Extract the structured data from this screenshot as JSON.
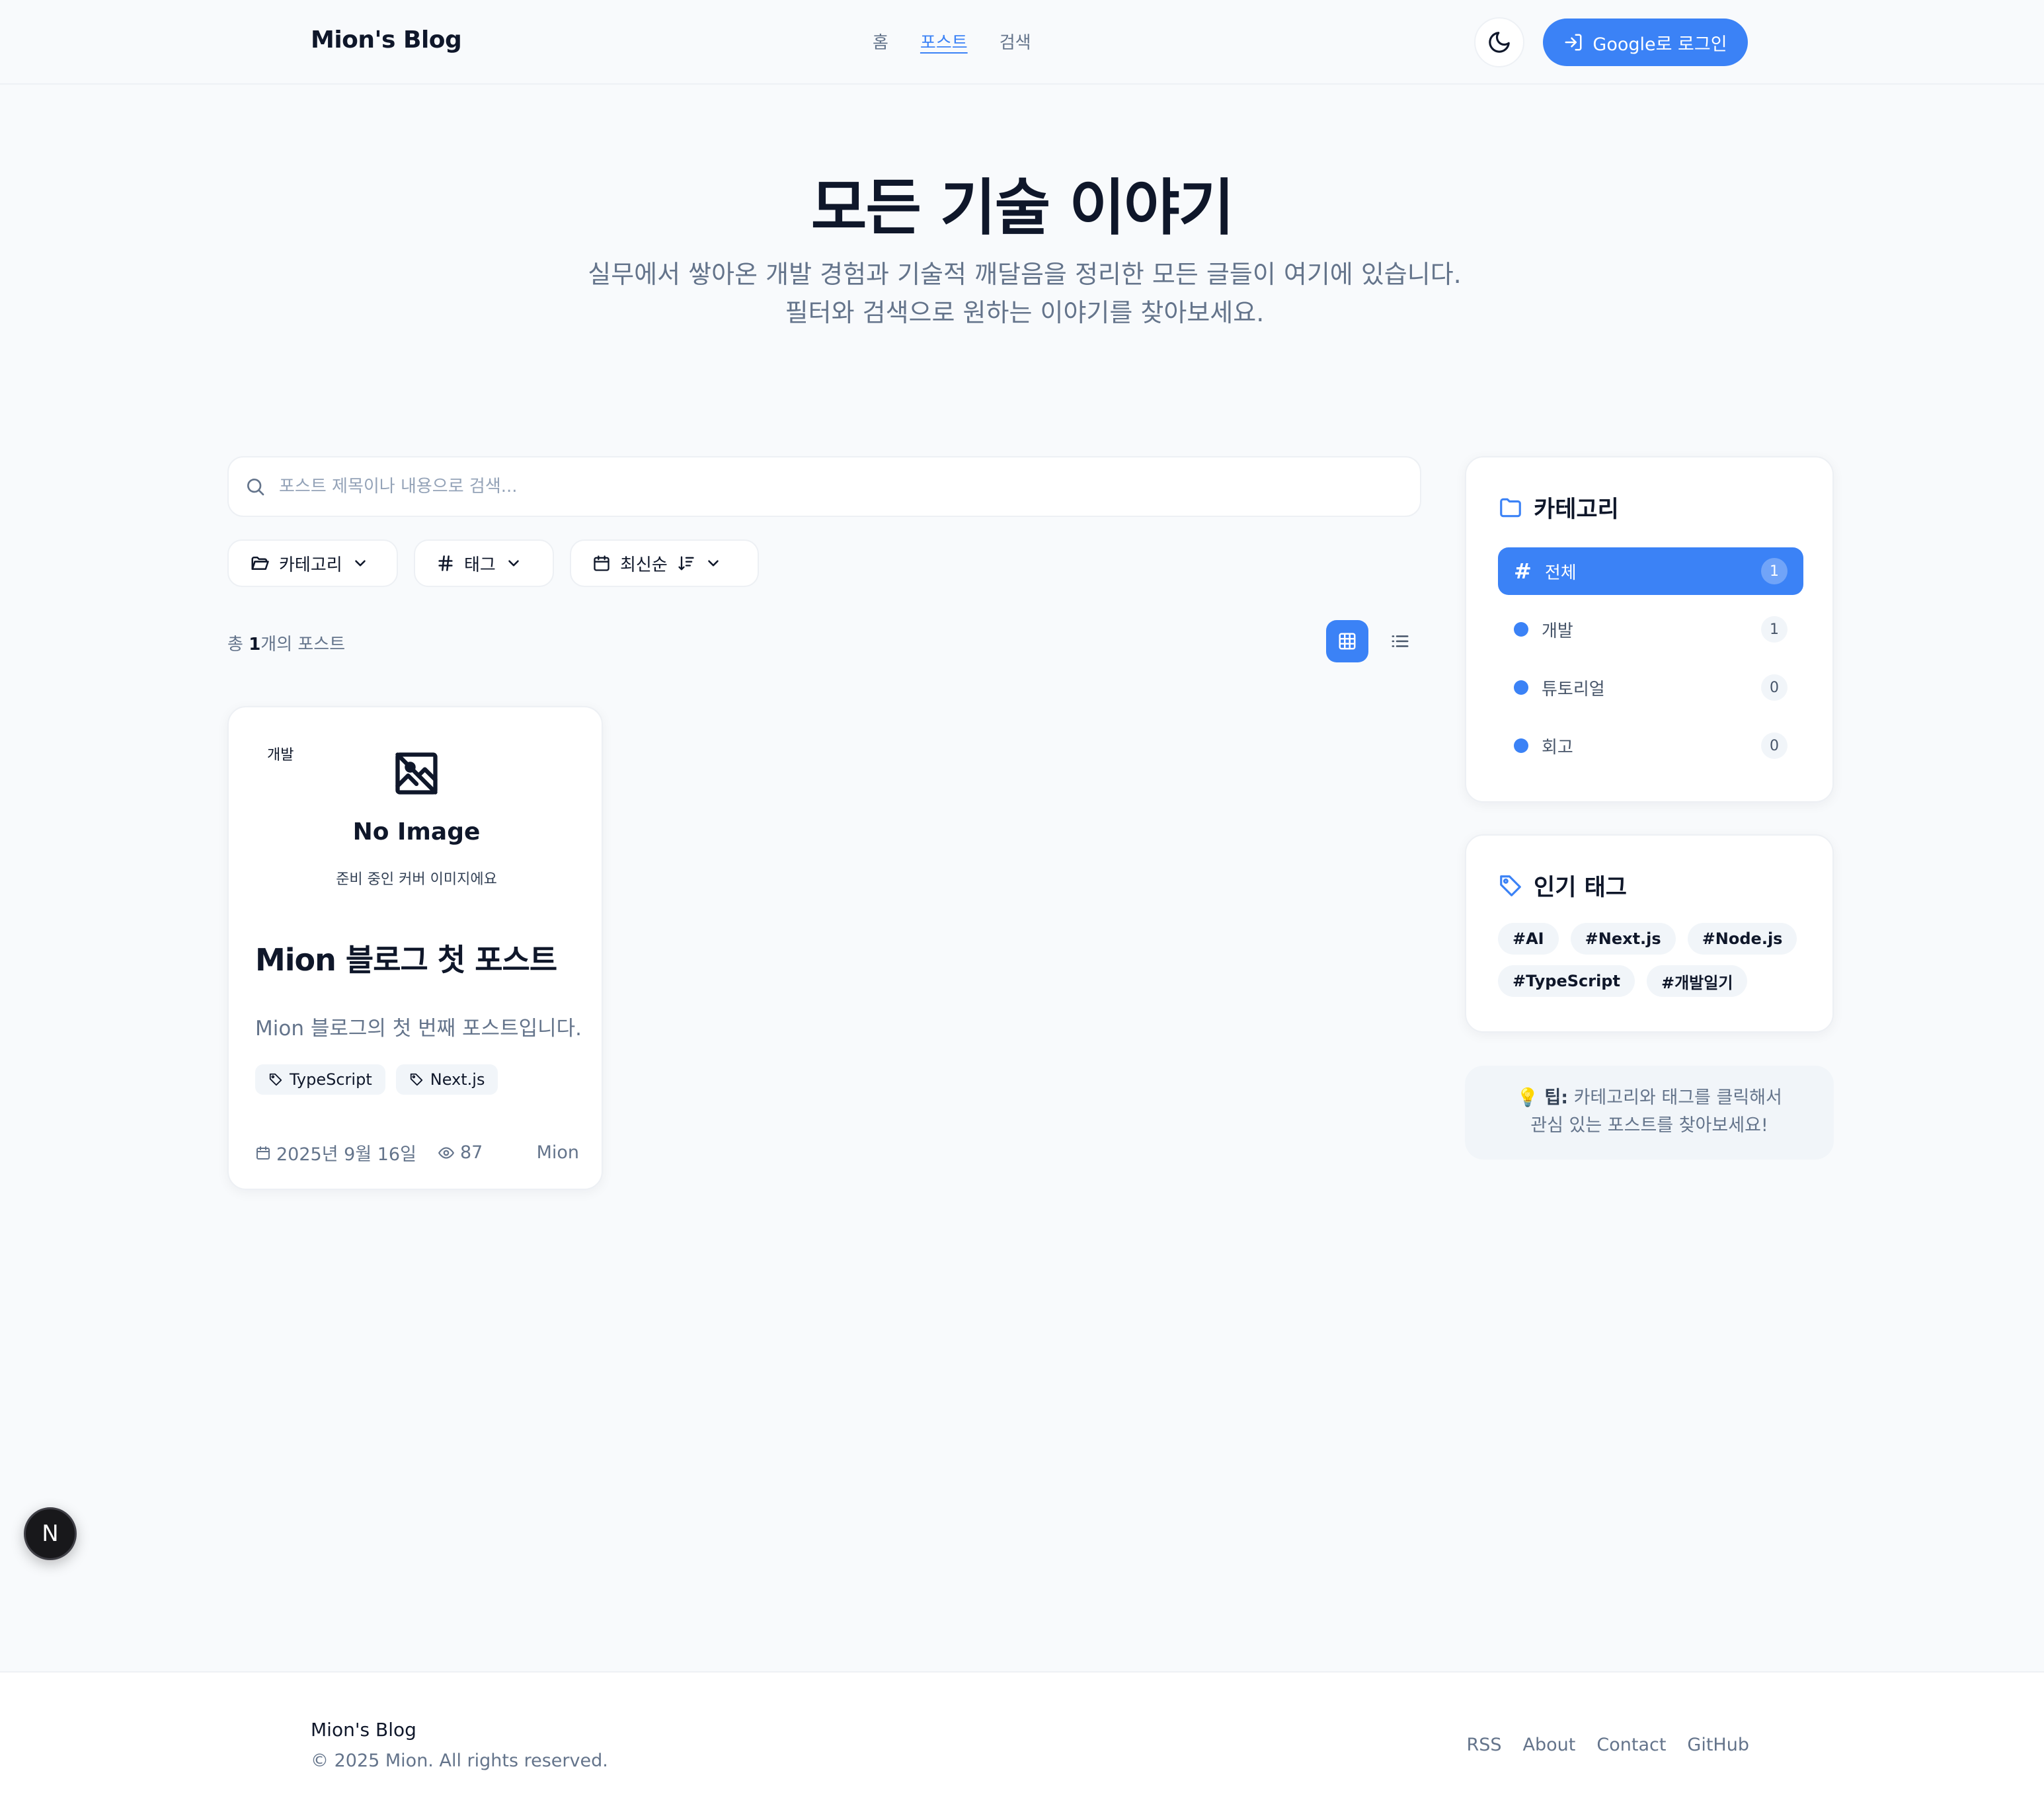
{
  "header": {
    "brand": "Mion's Blog",
    "nav": [
      {
        "label": "홈"
      },
      {
        "label": "포스트"
      },
      {
        "label": "검색"
      }
    ],
    "login_label": "Google로 로그인"
  },
  "hero": {
    "title": "모든 기술 이야기",
    "subtitle": "실무에서 쌓아온 개발 경험과 기술적 깨달음을 정리한 모든 글들이 여기에 있습니다. 필터와 검색으로 원하는 이야기를 찾아보세요."
  },
  "search": {
    "placeholder": "포스트 제목이나 내용으로 검색...",
    "value": ""
  },
  "filters": {
    "category": "카테고리",
    "tag": "태그",
    "sort": "최신순"
  },
  "results": {
    "prefix": "총 ",
    "count": "1",
    "suffix": "개의 포스트"
  },
  "post": {
    "category": "개발",
    "no_image_title": "No Image",
    "no_image_sub": "준비 중인 커버 이미지에요",
    "title": "Mion 블로그 첫 포스트",
    "excerpt": "Mion 블로그의 첫 번째 포스트입니다.",
    "tags": [
      "TypeScript",
      "Next.js"
    ],
    "date": "2025년 9월 16일",
    "views": "87",
    "author": "Mion"
  },
  "sidebar": {
    "categories_title": "카테고리",
    "categories": [
      {
        "label": "전체",
        "count": "1"
      },
      {
        "label": "개발",
        "count": "1"
      },
      {
        "label": "튜토리얼",
        "count": "0"
      },
      {
        "label": "회고",
        "count": "0"
      }
    ],
    "tags_title": "인기 태그",
    "tags": [
      "#AI",
      "#Next.js",
      "#Node.js",
      "#TypeScript",
      "#개발일기"
    ],
    "tip_label": "팁:",
    "tip_line1": "카테고리와 태그를 클릭해서",
    "tip_line2": "관심 있는 포스트를 찾아보세요!"
  },
  "floating": {
    "label": "N"
  },
  "footer": {
    "brand": "Mion's Blog",
    "copyright": "© 2025 Mion. All rights reserved.",
    "links": [
      "RSS",
      "About",
      "Contact",
      "GitHub"
    ]
  },
  "colors": {
    "accent": "#3b82f6",
    "text": "#0f172a",
    "muted": "#64748b",
    "background": "#f8fafc"
  }
}
